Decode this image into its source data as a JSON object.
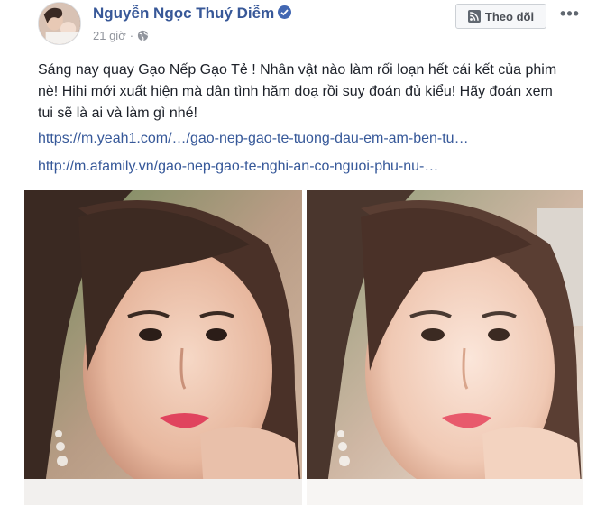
{
  "post": {
    "author": "Nguyễn Ngọc Thuý Diễm",
    "time": "21 giờ",
    "separator": "·",
    "follow_label": "Theo dõi",
    "more_label": "•••",
    "text": "Sáng nay quay Gạo Nếp Gạo Tẻ ! Nhân vật nào làm rối loạn hết cái kết của phim nè! Hihi mới xuất hiện mà dân tình hăm doạ rồi suy đoán đủ kiểu! Hãy đoán xem tui sẽ là ai và làm gì nhé!",
    "links": [
      "https://m.yeah1.com/…/gao-nep-gao-te-tuong-dau-em-am-ben-tu…",
      "http://m.afamily.vn/gao-nep-gao-te-nghi-an-co-nguoi-phu-nu-…"
    ],
    "photos": [
      "selfie-photo-1",
      "selfie-photo-2"
    ]
  },
  "colors": {
    "link": "#365899",
    "name": "#385898",
    "verified": "#4267b2",
    "meta": "#90949c"
  }
}
